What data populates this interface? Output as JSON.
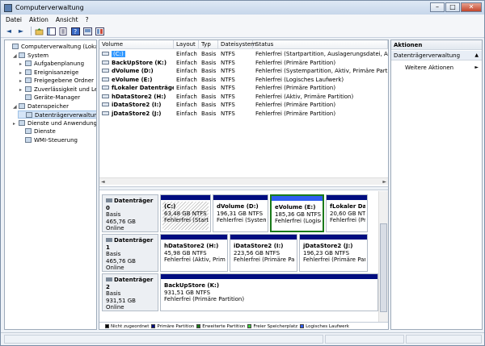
{
  "window": {
    "title": "Computerverwaltung",
    "buttons": [
      "–",
      "□",
      "✕"
    ]
  },
  "menu": [
    {
      "label": "Datei"
    },
    {
      "label": "Aktion"
    },
    {
      "label": "Ansicht"
    },
    {
      "label": "?"
    }
  ],
  "toolbar": {
    "back": "◄",
    "forward": "►"
  },
  "tree": [
    {
      "label": "Computerverwaltung (Lokal)",
      "expander": "",
      "depth": 0
    },
    {
      "label": "System",
      "expander": "◢",
      "depth": 1
    },
    {
      "label": "Aufgabenplanung",
      "expander": "▸",
      "depth": 2
    },
    {
      "label": "Ereignisanzeige",
      "expander": "▸",
      "depth": 2
    },
    {
      "label": "Freigegebene Ordner",
      "expander": "▸",
      "depth": 2
    },
    {
      "label": "Zuverlässigkeit und Leis",
      "expander": "▸",
      "depth": 2
    },
    {
      "label": "Geräte-Manager",
      "expander": "",
      "depth": 2
    },
    {
      "label": "Datenspeicher",
      "expander": "◢",
      "depth": 1
    },
    {
      "label": "Datenträgerverwaltung",
      "expander": "",
      "depth": 2,
      "selected": true
    },
    {
      "label": "Dienste und Anwendungen",
      "expander": "▸",
      "depth": 1
    },
    {
      "label": "Dienste",
      "expander": "",
      "depth": 2
    },
    {
      "label": "WMI-Steuerung",
      "expander": "",
      "depth": 2
    }
  ],
  "volume_list": {
    "columns": [
      "Volume",
      "Layout",
      "Typ",
      "Dateisystem",
      "Status"
    ],
    "rows": [
      [
        "(C:)",
        "Einfach",
        "Basis",
        "NTFS",
        "Fehlerfrei (Startpartition, Auslagerungsdatei, Absturz"
      ],
      [
        "BackUpStore (K:)",
        "Einfach",
        "Basis",
        "NTFS",
        "Fehlerfrei (Primäre Partition)"
      ],
      [
        "dVolume (D:)",
        "Einfach",
        "Basis",
        "NTFS",
        "Fehlerfrei (Systempartition, Aktiv, Primäre Partition)"
      ],
      [
        "eVolume (E:)",
        "Einfach",
        "Basis",
        "NTFS",
        "Fehlerfrei (Logisches Laufwerk)"
      ],
      [
        "fLokaler Datenträger (F:)",
        "Einfach",
        "Basis",
        "NTFS",
        "Fehlerfrei (Primäre Partition)"
      ],
      [
        "hDataStore2 (H:)",
        "Einfach",
        "Basis",
        "NTFS",
        "Fehlerfrei (Aktiv, Primäre Partition)"
      ],
      [
        "iDataStore2 (I:)",
        "Einfach",
        "Basis",
        "NTFS",
        "Fehlerfrei (Primäre Partition)"
      ],
      [
        "jDataStore2 (J:)",
        "Einfach",
        "Basis",
        "NTFS",
        "Fehlerfrei (Primäre Partition)"
      ]
    ]
  },
  "disks": [
    {
      "name": "Datenträger 0",
      "type": "Basis",
      "size": "465,76 GB",
      "status": "Online",
      "partitions": [
        {
          "name": "(C:)",
          "size": "63,48 GB NTFS",
          "status": "Fehlerfrei (Startp"
        },
        {
          "name": "dVolume  (D:)",
          "size": "196,31 GB NTFS",
          "status": "Fehlerfrei (Systemp"
        },
        {
          "name": "eVolume  (E:)",
          "size": "185,36 GB NTFS",
          "status": "Fehlerfrei (Logisc"
        },
        {
          "name": "fLokaler Daten",
          "size": "20,60 GB NTFS",
          "status": "Fehlerfrei (Prim"
        }
      ]
    },
    {
      "name": "Datenträger 1",
      "type": "Basis",
      "size": "465,76 GB",
      "status": "Online",
      "partitions": [
        {
          "name": "hDataStore2  (H:)",
          "size": "45,98 GB NTFS",
          "status": "Fehlerfrei (Aktiv, Prim"
        },
        {
          "name": "iDataStore2  (I:)",
          "size": "223,56 GB NTFS",
          "status": "Fehlerfrei (Primäre Partiti"
        },
        {
          "name": "jDataStore2  (J:)",
          "size": "196,23 GB NTFS",
          "status": "Fehlerfrei (Primäre Partiti"
        }
      ]
    },
    {
      "name": "Datenträger 2",
      "type": "Basis",
      "size": "931,51 GB",
      "status": "Online",
      "partitions": [
        {
          "name": "BackUpStore  (K:)",
          "size": "931,51 GB NTFS",
          "status": "Fehlerfrei (Primäre Partition)"
        }
      ]
    }
  ],
  "legend": [
    {
      "label": "Nicht zugeordnet",
      "color": "#000000"
    },
    {
      "label": "Primäre Partition",
      "color": "#000d80"
    },
    {
      "label": "Erweiterte Partition",
      "color": "#1a7a1a"
    },
    {
      "label": "Freier Speicherplatz",
      "color": "#40d040"
    },
    {
      "label": "Logisches Laufwerk",
      "color": "#2e5cf0"
    }
  ],
  "actions": {
    "header": "Aktionen",
    "section": "Datenträgerverwaltung",
    "more": "Weitere Aktionen",
    "chevron_up": "▲",
    "chevron_right": "►"
  }
}
